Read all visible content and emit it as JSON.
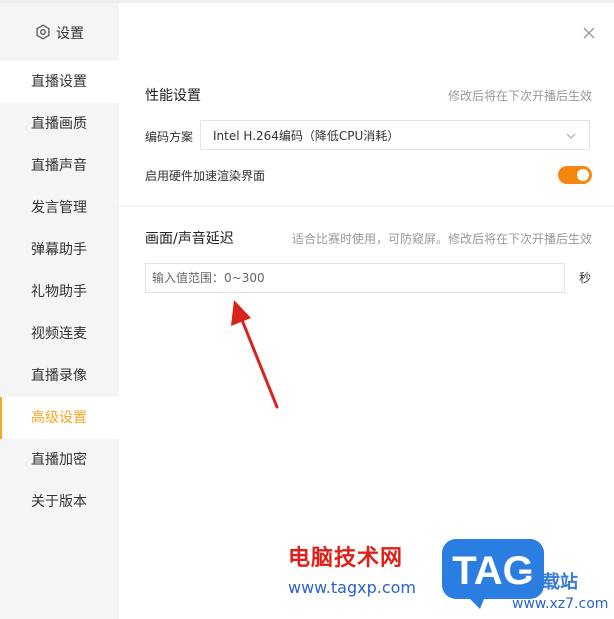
{
  "sidebar": {
    "title": "设置",
    "header_icon": "gear-icon",
    "items": [
      {
        "label": "直播设置"
      },
      {
        "label": "直播画质"
      },
      {
        "label": "直播声音"
      },
      {
        "label": "发言管理"
      },
      {
        "label": "弹幕助手"
      },
      {
        "label": "礼物助手"
      },
      {
        "label": "视频连麦"
      },
      {
        "label": "直播录像"
      },
      {
        "label": "高级设置"
      },
      {
        "label": "直播加密"
      },
      {
        "label": "关于版本"
      }
    ],
    "active_index": 8
  },
  "close_icon": "close-icon",
  "performance": {
    "title": "性能设置",
    "hint": "修改后将在下次开播后生效",
    "encoding_label": "编码方案",
    "encoding_value": "Intel H.264编码（降低CPU消耗）",
    "hw_label": "启用硬件加速渲染界面",
    "hw_enabled": true
  },
  "delay": {
    "title": "画面/声音延迟",
    "hint": "适合比赛时使用，可防窥屏。修改后将在下次开播后生效",
    "placeholder": "输入值范围：0~300",
    "unit": "秒"
  },
  "watermark": {
    "brand_text": "电脑技术网",
    "url": "www.tagxp.com",
    "logo_text": "TAG",
    "site_text": "下载站",
    "site_url": "www.xz7.com"
  },
  "colors": {
    "accent": "#f5a623",
    "toggle": "#f5870f",
    "arrow": "#d9231d"
  }
}
